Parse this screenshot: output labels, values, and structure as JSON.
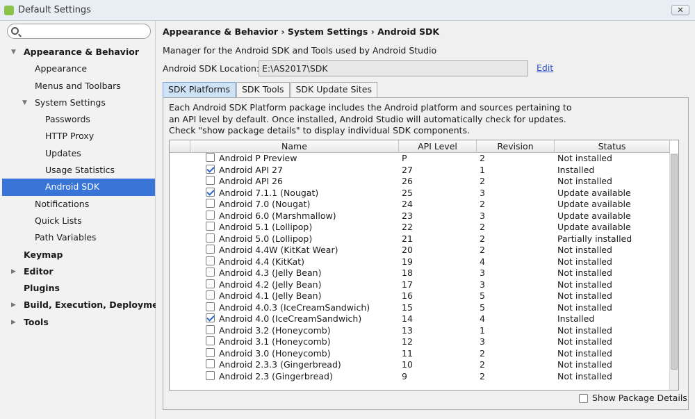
{
  "window": {
    "title": "Default Settings",
    "close_glyph": "✕",
    "icon": "android-studio-icon"
  },
  "search": {
    "placeholder": "",
    "value": ""
  },
  "sidebar": {
    "items": [
      {
        "label": "Appearance & Behavior",
        "level": 0,
        "arrow": "▼"
      },
      {
        "label": "Appearance",
        "level": 1
      },
      {
        "label": "Menus and Toolbars",
        "level": 1
      },
      {
        "label": "System Settings",
        "level": 1,
        "arrow": "▼"
      },
      {
        "label": "Passwords",
        "level": 2
      },
      {
        "label": "HTTP Proxy",
        "level": 2
      },
      {
        "label": "Updates",
        "level": 2
      },
      {
        "label": "Usage Statistics",
        "level": 2
      },
      {
        "label": "Android SDK",
        "level": 2,
        "selected": true
      },
      {
        "label": "Notifications",
        "level": 1
      },
      {
        "label": "Quick Lists",
        "level": 1
      },
      {
        "label": "Path Variables",
        "level": 1
      },
      {
        "label": "Keymap",
        "level": 0
      },
      {
        "label": "Editor",
        "level": 0,
        "arrow": "▶"
      },
      {
        "label": "Plugins",
        "level": 0
      },
      {
        "label": "Build, Execution, Deployment",
        "level": 0,
        "arrow": "▶"
      },
      {
        "label": "Tools",
        "level": 0,
        "arrow": "▶"
      }
    ]
  },
  "main": {
    "breadcrumb": "Appearance & Behavior  ›  System Settings  ›  Android SDK",
    "description": "Manager for the Android SDK and Tools used by Android Studio",
    "location_label": "Android SDK Location:",
    "location_value": "E:\\AS2017\\SDK",
    "edit_label": "Edit",
    "tabs": [
      "SDK Platforms",
      "SDK Tools",
      "SDK Update Sites"
    ],
    "info_text": "Each Android SDK Platform package includes the Android platform and sources pertaining to an API level by default. Once installed, Android Studio will automatically check for updates. Check \"show package details\" to display individual SDK components.",
    "columns": [
      "Name",
      "API Level",
      "Revision",
      "Status"
    ],
    "rows": [
      {
        "checked": false,
        "name": "Android P Preview",
        "api": "P",
        "rev": "2",
        "status": "Not installed"
      },
      {
        "checked": true,
        "name": "Android API 27",
        "api": "27",
        "rev": "1",
        "status": "Installed"
      },
      {
        "checked": false,
        "name": "Android API 26",
        "api": "26",
        "rev": "2",
        "status": "Not installed"
      },
      {
        "checked": true,
        "name": "Android 7.1.1 (Nougat)",
        "api": "25",
        "rev": "3",
        "status": "Update available"
      },
      {
        "checked": false,
        "name": "Android 7.0 (Nougat)",
        "api": "24",
        "rev": "2",
        "status": "Update available"
      },
      {
        "checked": false,
        "name": "Android 6.0 (Marshmallow)",
        "api": "23",
        "rev": "3",
        "status": "Update available"
      },
      {
        "checked": false,
        "name": "Android 5.1 (Lollipop)",
        "api": "22",
        "rev": "2",
        "status": "Update available"
      },
      {
        "checked": false,
        "name": "Android 5.0 (Lollipop)",
        "api": "21",
        "rev": "2",
        "status": "Partially installed"
      },
      {
        "checked": false,
        "name": "Android 4.4W (KitKat Wear)",
        "api": "20",
        "rev": "2",
        "status": "Not installed"
      },
      {
        "checked": false,
        "name": "Android 4.4 (KitKat)",
        "api": "19",
        "rev": "4",
        "status": "Not installed"
      },
      {
        "checked": false,
        "name": "Android 4.3 (Jelly Bean)",
        "api": "18",
        "rev": "3",
        "status": "Not installed"
      },
      {
        "checked": false,
        "name": "Android 4.2 (Jelly Bean)",
        "api": "17",
        "rev": "3",
        "status": "Not installed"
      },
      {
        "checked": false,
        "name": "Android 4.1 (Jelly Bean)",
        "api": "16",
        "rev": "5",
        "status": "Not installed"
      },
      {
        "checked": false,
        "name": "Android 4.0.3 (IceCreamSandwich)",
        "api": "15",
        "rev": "5",
        "status": "Not installed"
      },
      {
        "checked": true,
        "name": "Android 4.0 (IceCreamSandwich)",
        "api": "14",
        "rev": "4",
        "status": "Installed"
      },
      {
        "checked": false,
        "name": "Android 3.2 (Honeycomb)",
        "api": "13",
        "rev": "1",
        "status": "Not installed"
      },
      {
        "checked": false,
        "name": "Android 3.1 (Honeycomb)",
        "api": "12",
        "rev": "3",
        "status": "Not installed"
      },
      {
        "checked": false,
        "name": "Android 3.0 (Honeycomb)",
        "api": "11",
        "rev": "2",
        "status": "Not installed"
      },
      {
        "checked": false,
        "name": "Android 2.3.3 (Gingerbread)",
        "api": "10",
        "rev": "2",
        "status": "Not installed"
      },
      {
        "checked": false,
        "name": "Android 2.3 (Gingerbread)",
        "api": "9",
        "rev": "2",
        "status": "Not installed"
      }
    ],
    "show_details_label": "Show Package Details"
  }
}
